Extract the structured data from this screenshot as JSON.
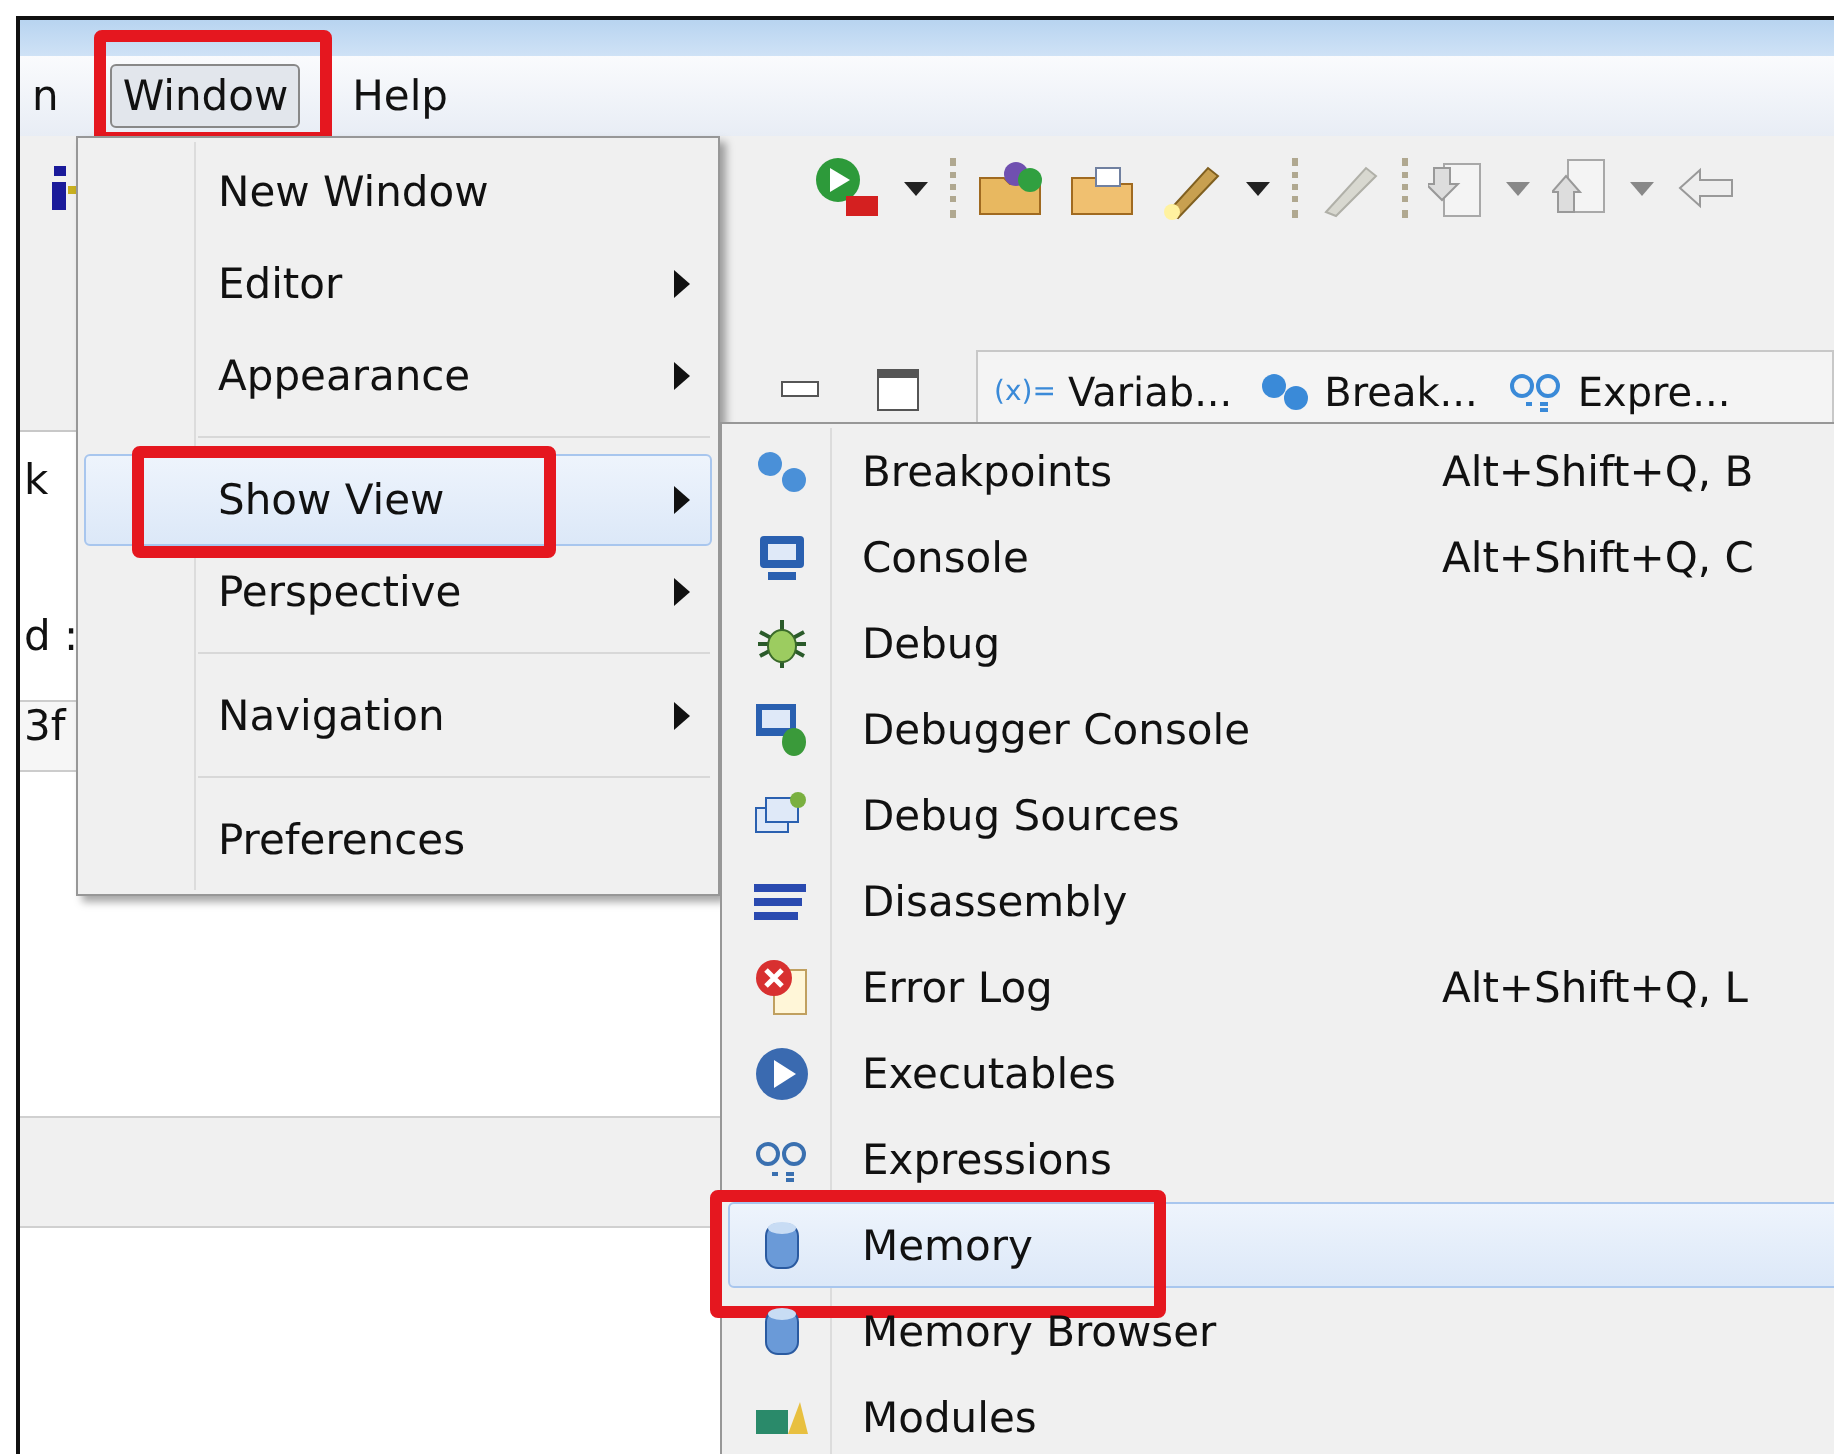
{
  "menu_bar": [
    {
      "label": "n",
      "selected": false,
      "highlighted": false
    },
    {
      "label": "Window",
      "selected": true,
      "highlighted": true
    },
    {
      "label": "Help",
      "selected": false,
      "highlighted": false
    }
  ],
  "editor_fragments": [
    "k",
    "d :"
  ],
  "editor_field": "3f",
  "view_tabs": [
    {
      "icon_text": "(x)=",
      "label": "Variab..."
    },
    {
      "label": "Break..."
    },
    {
      "label": "Expre..."
    }
  ],
  "window_menu": [
    {
      "kind": "item",
      "label": "New Window",
      "submenu": false,
      "selected": false,
      "highlighted": false
    },
    {
      "kind": "item",
      "label": "Editor",
      "submenu": true,
      "selected": false,
      "highlighted": false
    },
    {
      "kind": "item",
      "label": "Appearance",
      "submenu": true,
      "selected": false,
      "highlighted": false
    },
    {
      "kind": "separator"
    },
    {
      "kind": "item",
      "label": "Show View",
      "submenu": true,
      "selected": true,
      "highlighted": true
    },
    {
      "kind": "item",
      "label": "Perspective",
      "submenu": true,
      "selected": false,
      "highlighted": false
    },
    {
      "kind": "separator"
    },
    {
      "kind": "item",
      "label": "Navigation",
      "submenu": true,
      "selected": false,
      "highlighted": false
    },
    {
      "kind": "separator"
    },
    {
      "kind": "item",
      "label": "Preferences",
      "submenu": false,
      "selected": false,
      "highlighted": false
    }
  ],
  "show_view_menu": [
    {
      "label": "Breakpoints",
      "shortcut": "Alt+Shift+Q, B",
      "selected": false,
      "highlighted": false
    },
    {
      "label": "Console",
      "shortcut": "Alt+Shift+Q, C",
      "selected": false,
      "highlighted": false
    },
    {
      "label": "Debug",
      "selected": false,
      "highlighted": false
    },
    {
      "label": "Debugger Console",
      "selected": false,
      "highlighted": false
    },
    {
      "label": "Debug Sources",
      "selected": false,
      "highlighted": false
    },
    {
      "label": "Disassembly",
      "selected": false,
      "highlighted": false
    },
    {
      "label": "Error Log",
      "shortcut": "Alt+Shift+Q, L",
      "selected": false,
      "highlighted": false
    },
    {
      "label": "Executables",
      "selected": false,
      "highlighted": false
    },
    {
      "label": "Expressions",
      "selected": false,
      "highlighted": false
    },
    {
      "label": "Memory",
      "selected": true,
      "highlighted": true
    },
    {
      "label": "Memory Browser",
      "selected": false,
      "highlighted": false
    },
    {
      "label": "Modules",
      "selected": false,
      "highlighted": false
    }
  ]
}
